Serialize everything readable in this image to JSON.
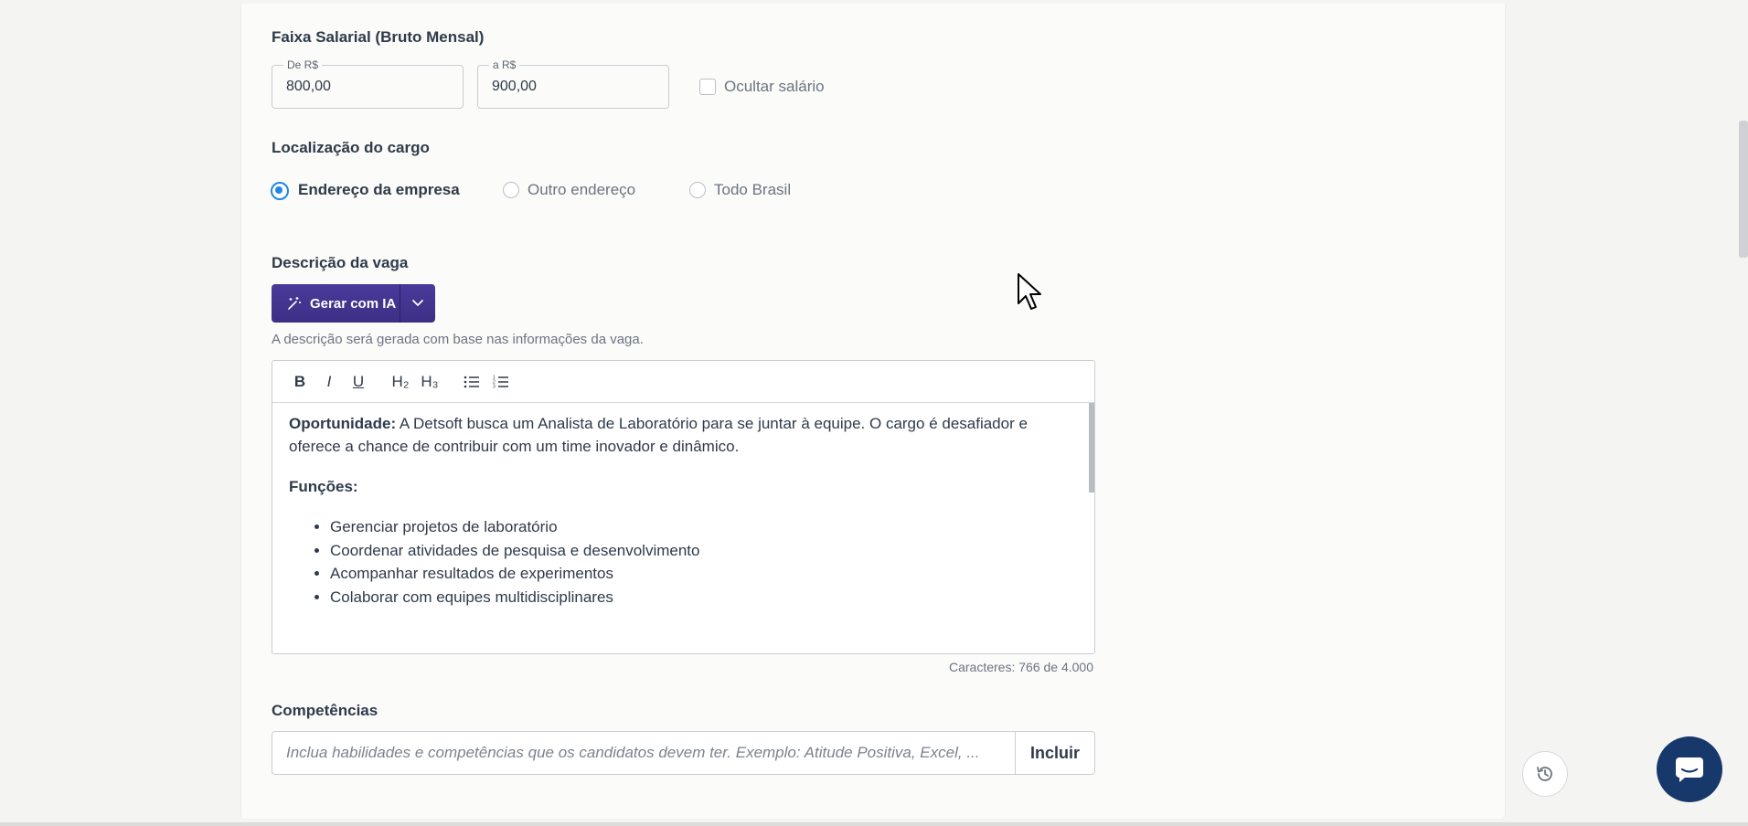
{
  "salary": {
    "title": "Faixa Salarial (Bruto Mensal)",
    "from_legend": "De R$",
    "from_value": "800,00",
    "to_legend": "a R$",
    "to_value": "900,00",
    "hide_label": "Ocultar salário",
    "hide_checked": false
  },
  "location": {
    "title": "Localização do cargo",
    "options": [
      {
        "label": "Endereço da empresa",
        "checked": true
      },
      {
        "label": "Outro endereço",
        "checked": false
      },
      {
        "label": "Todo Brasil",
        "checked": false
      }
    ]
  },
  "description": {
    "title": "Descrição da vaga",
    "ai_button_label": "Gerar com IA",
    "hint": "A descrição será gerada com base nas informações da vaga.",
    "toolbar": {
      "bold": "B",
      "italic": "I",
      "underline": "U",
      "h2": "H₂",
      "h3": "H₃"
    },
    "intro_label": "Oportunidade:",
    "intro_text": " A Detsoft busca um Analista de Laboratório para se juntar à equipe. O cargo é desafiador e oferece a chance de contribuir com um time inovador e dinâmico.",
    "functions_label": "Funções:",
    "functions": [
      "Gerenciar projetos de laboratório",
      "Coordenar atividades de pesquisa e desenvolvimento",
      "Acompanhar resultados de experimentos",
      "Colaborar com equipes multidisciplinares"
    ],
    "counter": "Caracteres: 766 de 4.000"
  },
  "competencies": {
    "title": "Competências",
    "placeholder": "Inclua habilidades e competências que os candidatos devem ter. Exemplo: Atitude Positiva, Excel, ...",
    "button_label": "Incluir"
  },
  "colors": {
    "accent": "#1e88e5",
    "ai_button": "#3d2f86",
    "chat_button": "#17386b"
  },
  "icons": {
    "ai": "magic-wand-icon",
    "dropdown": "chevron-down-icon",
    "history": "history-icon",
    "chat": "chat-icon"
  }
}
